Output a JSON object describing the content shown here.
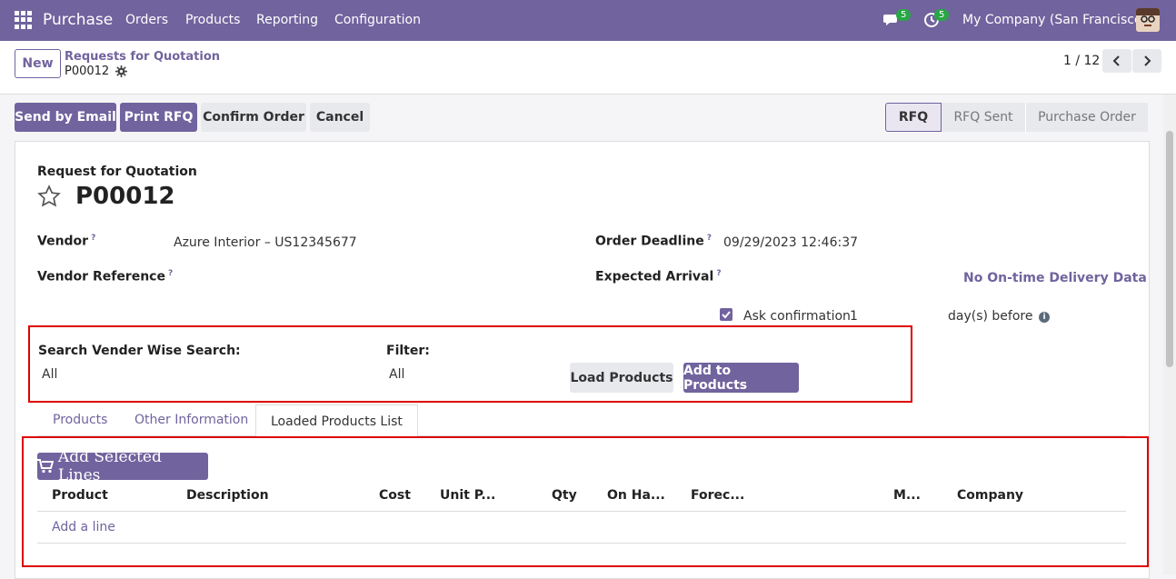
{
  "navbar": {
    "app_name": "Purchase",
    "menu": [
      "Orders",
      "Products",
      "Reporting",
      "Configuration"
    ],
    "chat_count": "5",
    "activity_count": "5",
    "company": "My Company (San Francisco)"
  },
  "control_panel": {
    "new_label": "New",
    "breadcrumb_parent": "Requests for Quotation",
    "record_name": "P00012",
    "pager": "1 / 12"
  },
  "actions": {
    "send_email": "Send by Email",
    "print_rfq": "Print RFQ",
    "confirm_order": "Confirm Order",
    "cancel": "Cancel"
  },
  "statusbar": [
    "RFQ",
    "RFQ Sent",
    "Purchase Order"
  ],
  "form": {
    "subtitle": "Request for Quotation",
    "title": "P00012",
    "vendor_label": "Vendor",
    "vendor_value": "Azure Interior – US12345677",
    "vendor_ref_label": "Vendor Reference",
    "order_deadline_label": "Order Deadline",
    "order_deadline_value": "09/29/2023 12:46:37",
    "expected_arrival_label": "Expected Arrival",
    "on_time_text": "No On-time Delivery Data",
    "ask_confirmation_label": "Ask confirmation",
    "ask_confirmation_days": "1",
    "days_before": "day(s) before",
    "help_mark": "?"
  },
  "search_panel": {
    "search_label": "Search Vender Wise Search:",
    "search_value": "All",
    "filter_label": "Filter:",
    "filter_value": "All",
    "load_products": "Load Products",
    "add_to_products": "Add to Products"
  },
  "tabs": [
    "Products",
    "Other Information",
    "Loaded Products List"
  ],
  "loaded_list": {
    "add_selected_label": "Add Selected Lines",
    "columns": [
      "Product",
      "Description",
      "Cost",
      "Unit P...",
      "Qty",
      "On Ha...",
      "Forec...",
      "M...",
      "Company"
    ],
    "add_line": "Add a line"
  },
  "colors": {
    "brand": "#71639e",
    "badge": "#28a745",
    "highlight": "#dd0000"
  }
}
